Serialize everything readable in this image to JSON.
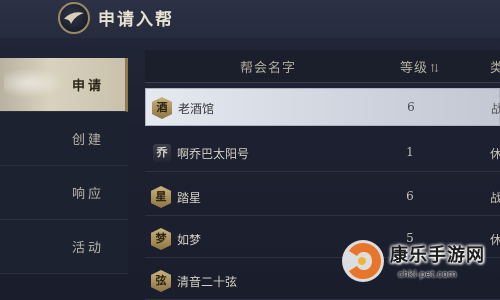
{
  "header": {
    "title": "申请入帮"
  },
  "tabs": [
    {
      "label": "申请",
      "active": true
    },
    {
      "label": "创建",
      "active": false
    },
    {
      "label": "响应",
      "active": false
    },
    {
      "label": "活动",
      "active": false
    }
  ],
  "table": {
    "columns": {
      "name": "帮会名字",
      "level": "等级",
      "level_sort": "⇅",
      "type": "类"
    },
    "rows": [
      {
        "badge": "酒",
        "name": "老酒馆",
        "level": "6",
        "type": "战",
        "selected": true
      },
      {
        "badge": "乔",
        "name": "啊乔巴太阳号",
        "level": "1",
        "type": "休",
        "selected": false
      },
      {
        "badge": "星",
        "name": "踏星",
        "level": "6",
        "type": "战",
        "selected": false
      },
      {
        "badge": "梦",
        "name": "如梦",
        "level": "5",
        "type": "休",
        "selected": false
      },
      {
        "badge": "弦",
        "name": "清音二十弦",
        "level": "",
        "type": "",
        "selected": false
      }
    ]
  },
  "watermark": {
    "title": "康乐手游网",
    "url": "chkl-pet.com"
  },
  "colors": {
    "accent_gold": "#9c8a62",
    "selected_row": "#dfe3ea",
    "active_tab": "#d2cab5"
  }
}
